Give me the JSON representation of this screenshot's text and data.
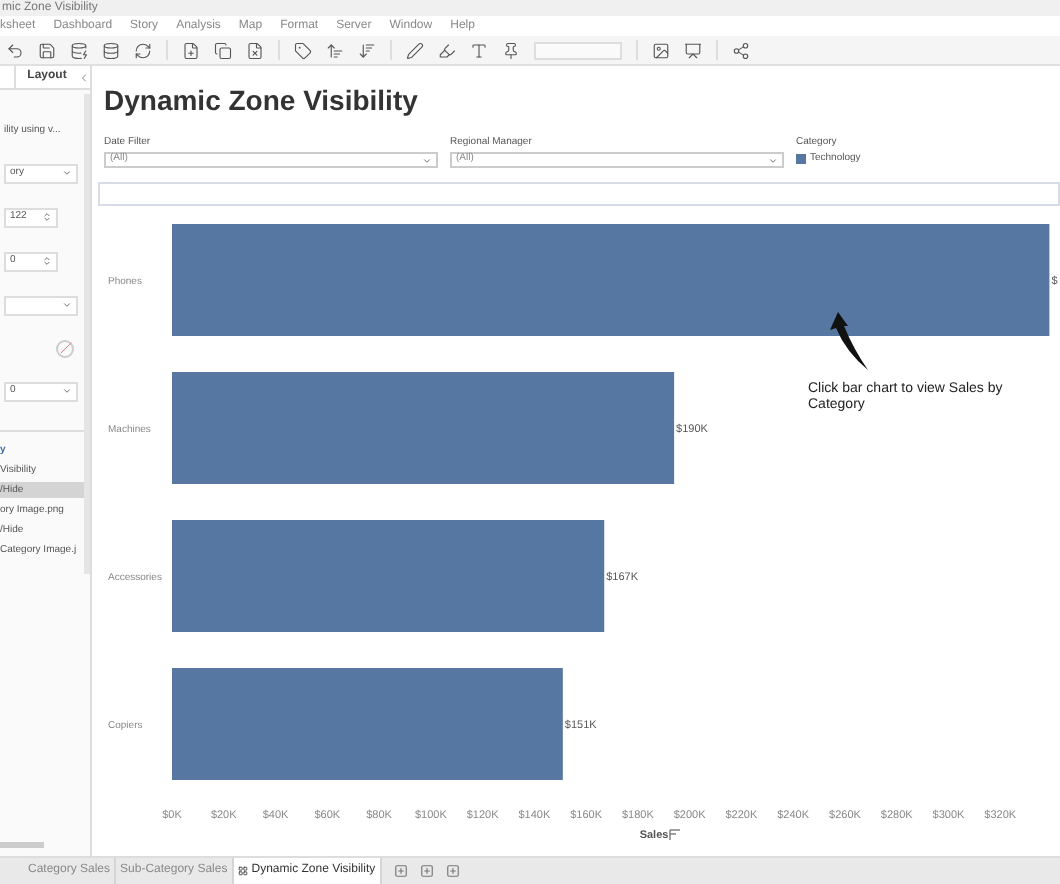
{
  "window": {
    "title": "mic Zone Visibility"
  },
  "menu": [
    "ksheet",
    "Dashboard",
    "Story",
    "Analysis",
    "Map",
    "Format",
    "Server",
    "Window",
    "Help"
  ],
  "left_panel": {
    "tab": "Layout",
    "fields": [
      {
        "kind": "text",
        "value": "ility using v..."
      },
      {
        "kind": "select",
        "value": "ory"
      },
      {
        "kind": "spin",
        "value": "122"
      },
      {
        "kind": "spin",
        "value": "0"
      },
      {
        "kind": "select"
      },
      {
        "kind": "swatch"
      },
      {
        "kind": "select",
        "value": "0"
      }
    ],
    "tree": {
      "heading": "y",
      "items": [
        {
          "label": "Visibility",
          "selected": false
        },
        {
          "label": "/Hide",
          "selected": true
        },
        {
          "label": "ory Image.png",
          "selected": false
        },
        {
          "label": "/Hide",
          "selected": false
        },
        {
          "label": "Category Image.j",
          "selected": false
        }
      ]
    }
  },
  "dashboard": {
    "title": "Dynamic Zone Visibility",
    "filters": [
      {
        "label": "Date Filter",
        "value": "(All)"
      },
      {
        "label": "Regional Manager",
        "value": "(All)"
      }
    ],
    "legend": {
      "title": "Category",
      "items": [
        {
          "label": "Technology",
          "color": "#5577a2"
        }
      ]
    },
    "callout": "Click bar chart to view Sales by Category",
    "chart_data": {
      "type": "bar",
      "orientation": "horizontal",
      "xlabel": "Sales",
      "categories": [
        "Phones",
        "Machines",
        "Accessories",
        "Copiers"
      ],
      "xlim": [
        0,
        340000
      ],
      "series": [
        {
          "color": "#5577a2",
          "values": [
            339000,
            194000,
            167000,
            151000
          ]
        }
      ],
      "value_labels": [
        "$",
        "$190K",
        "$167K",
        "$151K"
      ],
      "xticks": [
        {
          "value": 0,
          "label": "$0K"
        },
        {
          "value": 20000,
          "label": "$20K"
        },
        {
          "value": 40000,
          "label": "$40K"
        },
        {
          "value": 60000,
          "label": "$60K"
        },
        {
          "value": 80000,
          "label": "$80K"
        },
        {
          "value": 100000,
          "label": "$100K"
        },
        {
          "value": 120000,
          "label": "$120K"
        },
        {
          "value": 140000,
          "label": "$140K"
        },
        {
          "value": 160000,
          "label": "$160K"
        },
        {
          "value": 180000,
          "label": "$180K"
        },
        {
          "value": 200000,
          "label": "$200K"
        },
        {
          "value": 220000,
          "label": "$220K"
        },
        {
          "value": 240000,
          "label": "$240K"
        },
        {
          "value": 260000,
          "label": "$260K"
        },
        {
          "value": 280000,
          "label": "$280K"
        },
        {
          "value": 300000,
          "label": "$300K"
        },
        {
          "value": 320000,
          "label": "$320K"
        }
      ]
    }
  },
  "sheet_tabs": [
    {
      "label": "Category Sales",
      "selected": false
    },
    {
      "label": "Sub-Category Sales",
      "selected": false
    },
    {
      "label": "Dynamic Zone Visibility",
      "selected": true
    }
  ]
}
